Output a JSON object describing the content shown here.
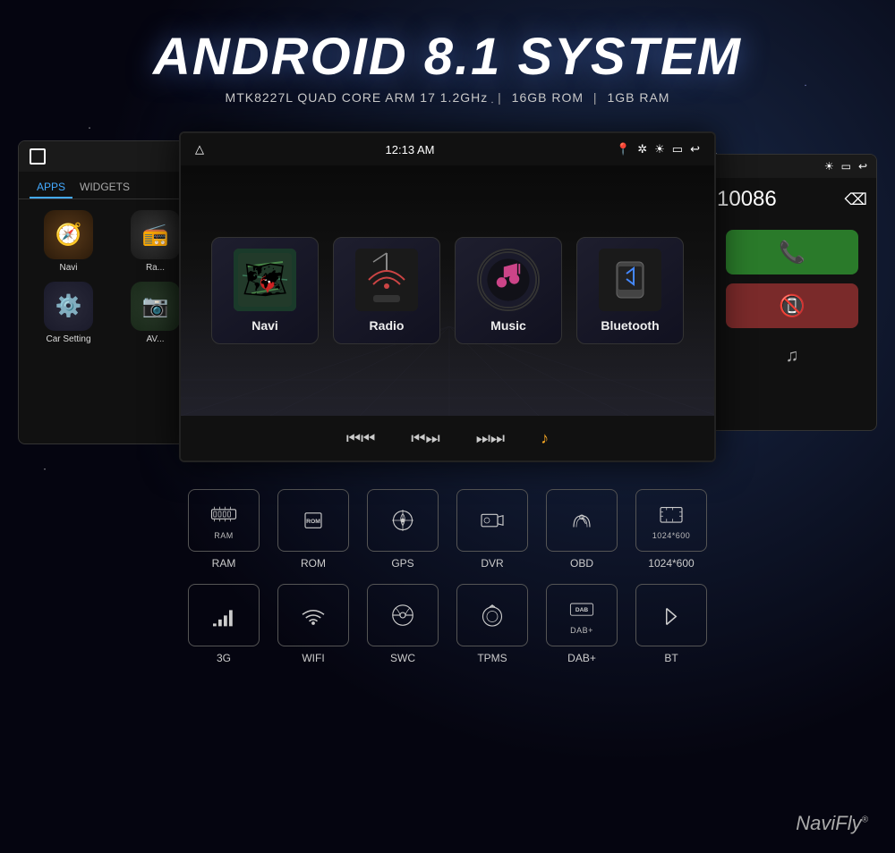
{
  "header": {
    "main_title": "ANDROID 8.1 SYSTEM",
    "sub_title": "MTK8227L QUAD CORE ARM 17 1.2GHz",
    "spec_rom": "16GB ROM",
    "spec_ram": "1GB RAM"
  },
  "left_screen": {
    "tabs": [
      "APPS",
      "WIDGETS"
    ],
    "active_tab": "APPS",
    "apps": [
      {
        "name": "Navi",
        "icon": "🧭"
      },
      {
        "name": "Ra...",
        "icon": "📻"
      },
      {
        "name": "Car Setting",
        "icon": "⚙️"
      },
      {
        "name": "AV...",
        "icon": "📷"
      }
    ]
  },
  "center_screen": {
    "status_bar": {
      "time": "12:13 AM",
      "icons": [
        "📍",
        "🔵",
        "☀",
        "🔋",
        "↩"
      ]
    },
    "apps": [
      {
        "id": "navi",
        "label": "Navi"
      },
      {
        "id": "radio",
        "label": "Radio"
      },
      {
        "id": "music",
        "label": "Music"
      },
      {
        "id": "bluetooth",
        "label": "Bluetooth"
      }
    ],
    "controls": [
      "⏮",
      "⏯",
      "⏭",
      "🎵"
    ]
  },
  "right_screen": {
    "phone_number": "10086",
    "call_accept": "📞",
    "call_decline": "📵"
  },
  "features_row1": [
    {
      "icon": "RAM",
      "label": "RAM",
      "type": "text"
    },
    {
      "icon": "ROM",
      "label": "ROM",
      "type": "text"
    },
    {
      "icon": "gps",
      "label": "GPS",
      "type": "svg"
    },
    {
      "icon": "dvr",
      "label": "DVR",
      "type": "svg"
    },
    {
      "icon": "obd",
      "label": "OBD",
      "type": "svg"
    },
    {
      "icon": "resolution",
      "label": "1024*600",
      "type": "text"
    }
  ],
  "features_row2": [
    {
      "icon": "3g",
      "label": "3G",
      "type": "signal"
    },
    {
      "icon": "wifi",
      "label": "WIFI",
      "type": "wifi"
    },
    {
      "icon": "swc",
      "label": "SWC",
      "type": "steering"
    },
    {
      "icon": "tpms",
      "label": "TPMS",
      "type": "tire"
    },
    {
      "icon": "dab",
      "label": "DAB+",
      "type": "text_dab"
    },
    {
      "icon": "bt",
      "label": "BT",
      "type": "bt"
    }
  ],
  "brand": {
    "name": "NaviFly",
    "trademark": "®"
  }
}
